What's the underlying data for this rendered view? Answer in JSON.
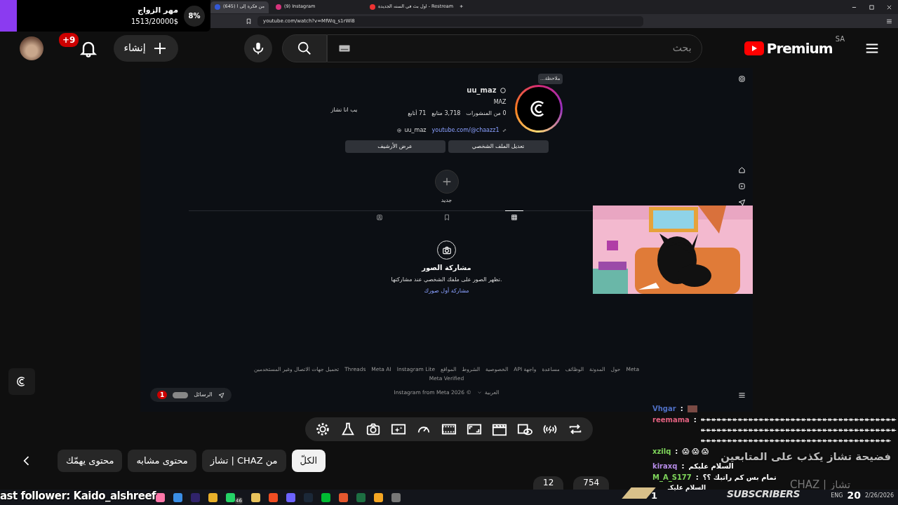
{
  "goal_overlay": {
    "percent": "8%",
    "title": "مهر الزواج",
    "amount": "1513/20000$",
    "level": 0.08
  },
  "browser": {
    "tabs": [
      {
        "title": "اول بث في السنه الجديدة - Restream",
        "selected": false
      },
      {
        "title": "(9) Instagram",
        "selected": false
      },
      {
        "title": "(645) من فكرة إلى ا",
        "selected": true
      }
    ],
    "new_tab": "+",
    "url": "youtube.com/watch?v=MfWq_s1rWl8"
  },
  "youtube_header": {
    "logo": "Premium",
    "region": "SA",
    "search_placeholder": "بحث",
    "create": "إنشاء",
    "notifications": "+9"
  },
  "instagram": {
    "note": "ملاحظة...",
    "username": "uu_maz",
    "name": "MAZ",
    "stats": [
      "0 من المنشورات",
      "3,718 متابع",
      "71 أتابع"
    ],
    "bio": "يب انا تشاز",
    "link": "youtube.com/@chaazz1",
    "threads": "uu_maz",
    "buttons": [
      "تعديل الملف الشخصي",
      "عرض الأرشيف"
    ],
    "new_highlight": "جديد",
    "tabs": [
      {
        "kind": "grid",
        "selected": true
      },
      {
        "kind": "saved",
        "selected": false
      },
      {
        "kind": "tagged",
        "selected": false
      }
    ],
    "empty_title": "مشاركة الصور",
    "empty_text": "تظهر الصور على ملفك الشخصي عند مشاركتها.",
    "empty_link": "مشاركة أول صورك",
    "footer_links": [
      "Meta",
      "حول",
      "المدونة",
      "الوظائف",
      "مساعدة",
      "واجهة API",
      "الخصوصية",
      "الشروط",
      "المواقع",
      "Instagram Lite",
      "Meta AI",
      "Threads",
      "تحميل جهات الاتصال وغير المستخدمين",
      "Meta Verified"
    ],
    "language": "العربية",
    "copyright": "© 2026 Instagram from Meta",
    "messages": "الرسائل",
    "messages_badge": "1"
  },
  "chips": [
    {
      "label": "الكلّ",
      "selected": true
    },
    {
      "label": "من CHAZ | تشاز",
      "selected": false
    },
    {
      "label": "محتوى مشابه",
      "selected": false
    },
    {
      "label": "محتوى يهمّك",
      "selected": false
    }
  ],
  "action_counts": [
    "754",
    "12"
  ],
  "chat": [
    {
      "user": "Vhgar",
      "separator": ":",
      "color": "#4f6fc4"
    },
    {
      "user": "reemama",
      "separator": ":",
      "color": "#e0607e",
      "text": "↞↞↞↞↞↞↞↞↞↞↞↞↞↞↞↞↞↞↞↞↞↞↞↞↞↞↞↞↞↞↞↞↞↞↞↞↞↞↞↞↞↞↞↞↞↞↞↞↞↞↞↞↞↞↞↞↞↞↞↞↞↞↞↞↞↞↞↞↞↞↞↞↞↞↞↞↞↞↞↞↞↞↞↞↞↞↞↞↞↞↞↞↞↞↞↞↞↞↞↞↞↞↞↞↞↞↞↞↞↞"
    },
    {
      "user": "xzilq",
      "separator": ":",
      "color": "#7fd65b",
      "text": "😱 😱 😱"
    },
    {
      "user": "kiraxq",
      "separator": ":",
      "color": "#b58be6",
      "text": "السلام عليكم"
    },
    {
      "user": "M_A_S177",
      "separator": ":",
      "color": "#7fd65b",
      "text": "تمام بس كم راتبك ؟؟"
    }
  ],
  "chat_partial": "السلام عليكـ",
  "scandal_banner": "فضيحة تشاز يكذب على المتابعين",
  "channel_watermark": "CHAZ | تشاز",
  "subscribers": {
    "label": "SUBSCRIBERS",
    "count": "1",
    "goal": "20"
  },
  "last_follower": "ast follower: Kaido_alshreef",
  "taskbar": {
    "whatsapp_badge": "46",
    "language": "ENG",
    "date": "2/26/2026"
  }
}
